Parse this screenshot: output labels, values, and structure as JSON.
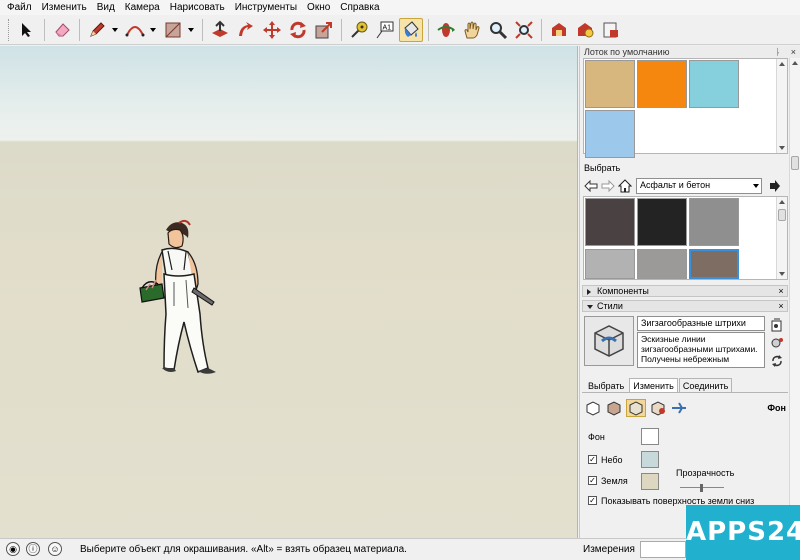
{
  "menu": [
    "Файл",
    "Изменить",
    "Вид",
    "Камера",
    "Нарисовать",
    "Инструменты",
    "Окно",
    "Справка"
  ],
  "default_tray": {
    "title": "Лоток по умолчанию",
    "pin": "ᚿ",
    "close": "×"
  },
  "materials_top": {
    "swatches": [
      "#d7b77d",
      "#f5870e",
      "#85d0dc",
      "#9cc8ec"
    ]
  },
  "select": {
    "label": "Выбрать",
    "dropdown_value": "Асфальт и бетон",
    "swatches": [
      "#4a4143",
      "#232323",
      "#8f8f8f",
      "#b2b2b2",
      "#9c9a98",
      "#7d6d62"
    ]
  },
  "components": {
    "label": "Компоненты",
    "close": "×"
  },
  "styles": {
    "label": "Стили",
    "close": "×",
    "style_name": "Зигзагообразные штрихи",
    "description": "Эскизные линии зигзагообразными штрихами. Получены небрежным",
    "tabs": [
      "Выбрать",
      "Изменить",
      "Соединить"
    ],
    "selected_tab": "Изменить",
    "edit_section": "Фон",
    "background_label": "Фон",
    "sky_label": "Небо",
    "ground_label": "Земля",
    "transparency_label": "Прозрачность",
    "show_ground_label": "Показывать поверхность земли сниз",
    "background_color": "#ffffff",
    "sky_color": "#c7d9db",
    "ground_color": "#ddd7c1"
  },
  "status": {
    "message": "Выберите объект для окрашивания. «Alt» = взять образец материала.",
    "measurements_label": "Измерения"
  },
  "watermark": "APPS24"
}
